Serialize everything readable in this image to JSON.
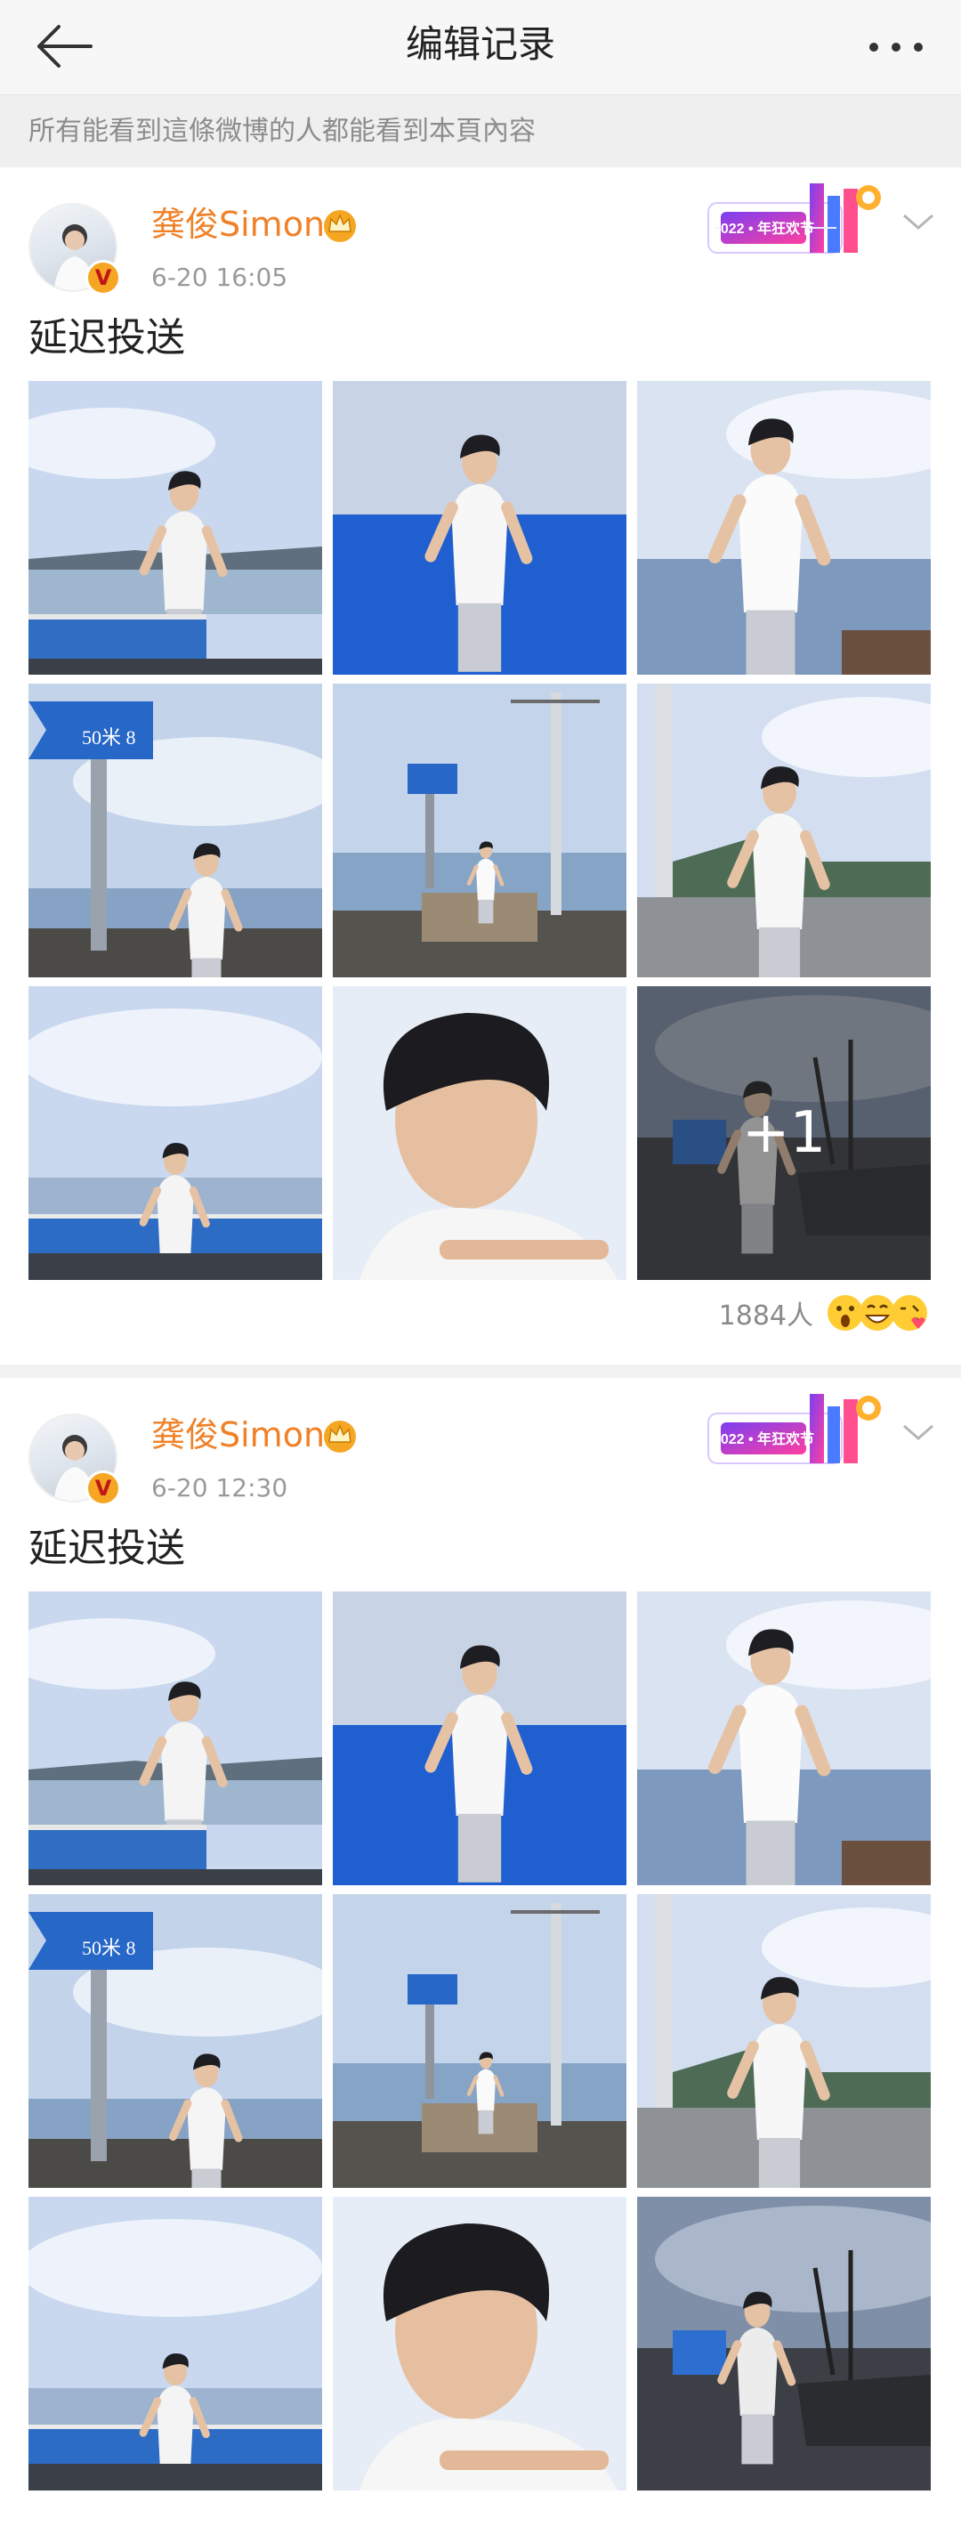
{
  "nav": {
    "title": "编辑记录",
    "back_icon": "arrow-left-icon",
    "more_icon": "more-dots-icon"
  },
  "notice": "所有能看到這條微博的人都能看到本頁內容",
  "colors": {
    "accent_orange": "#f08127",
    "text_gray": "#9a9a9a",
    "notice_bg": "#efefef"
  },
  "posts": [
    {
      "user_name": "龚俊Simon",
      "time": "6-20 16:05",
      "text": "延迟投送",
      "event_badge_text": "2022 • 年狂欢节",
      "more_photos_label": "+1",
      "reaction_count": "1884人",
      "reaction_icons": [
        "surprised-face-icon",
        "grinning-face-icon",
        "blowing-kiss-face-icon"
      ],
      "photos": [
        "man-railing-seaside",
        "man-blue-wall",
        "man-pier-sea",
        "sign-seated-man",
        "signpost-pole-scene",
        "man-thinking-pole",
        "man-railing-distant",
        "man-closeup-profile",
        "man-dock-boat"
      ]
    },
    {
      "user_name": "龚俊Simon",
      "time": "6-20 12:30",
      "text": "延迟投送",
      "event_badge_text": "2022 • 年狂欢节",
      "photos": [
        "man-railing-seaside",
        "man-blue-wall",
        "man-pier-sea",
        "sign-seated-man",
        "signpost-pole-scene",
        "man-thinking-pole",
        "man-railing-distant",
        "man-closeup-profile",
        "man-dock-boat"
      ]
    }
  ]
}
